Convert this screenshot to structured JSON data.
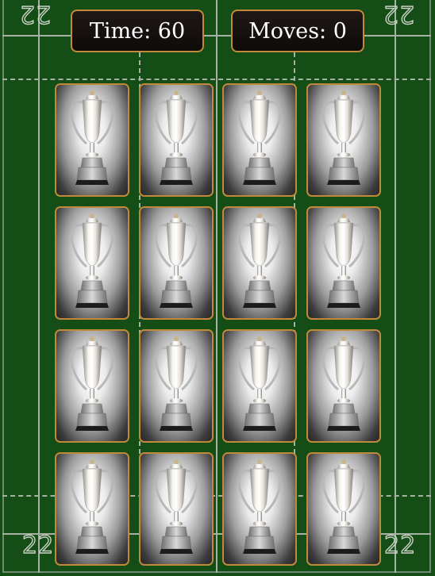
{
  "hud": {
    "time_text": "Time: 60",
    "moves_text": "Moves: 0"
  },
  "field": {
    "top_numbers": [
      "22",
      "22"
    ],
    "bottom_numbers": [
      "22",
      "22"
    ]
  },
  "cards": [
    {
      "face": "trophy-icon"
    },
    {
      "face": "trophy-icon"
    },
    {
      "face": "trophy-icon"
    },
    {
      "face": "trophy-icon"
    },
    {
      "face": "trophy-icon"
    },
    {
      "face": "trophy-icon"
    },
    {
      "face": "trophy-icon"
    },
    {
      "face": "trophy-icon"
    },
    {
      "face": "trophy-icon"
    },
    {
      "face": "trophy-icon"
    },
    {
      "face": "trophy-icon"
    },
    {
      "face": "trophy-icon"
    },
    {
      "face": "trophy-icon"
    },
    {
      "face": "trophy-icon"
    },
    {
      "face": "trophy-icon"
    },
    {
      "face": "trophy-icon"
    }
  ],
  "colors": {
    "field": "#154d17",
    "card_border": "#c08a3a",
    "hud_bg": "#120d0c"
  }
}
